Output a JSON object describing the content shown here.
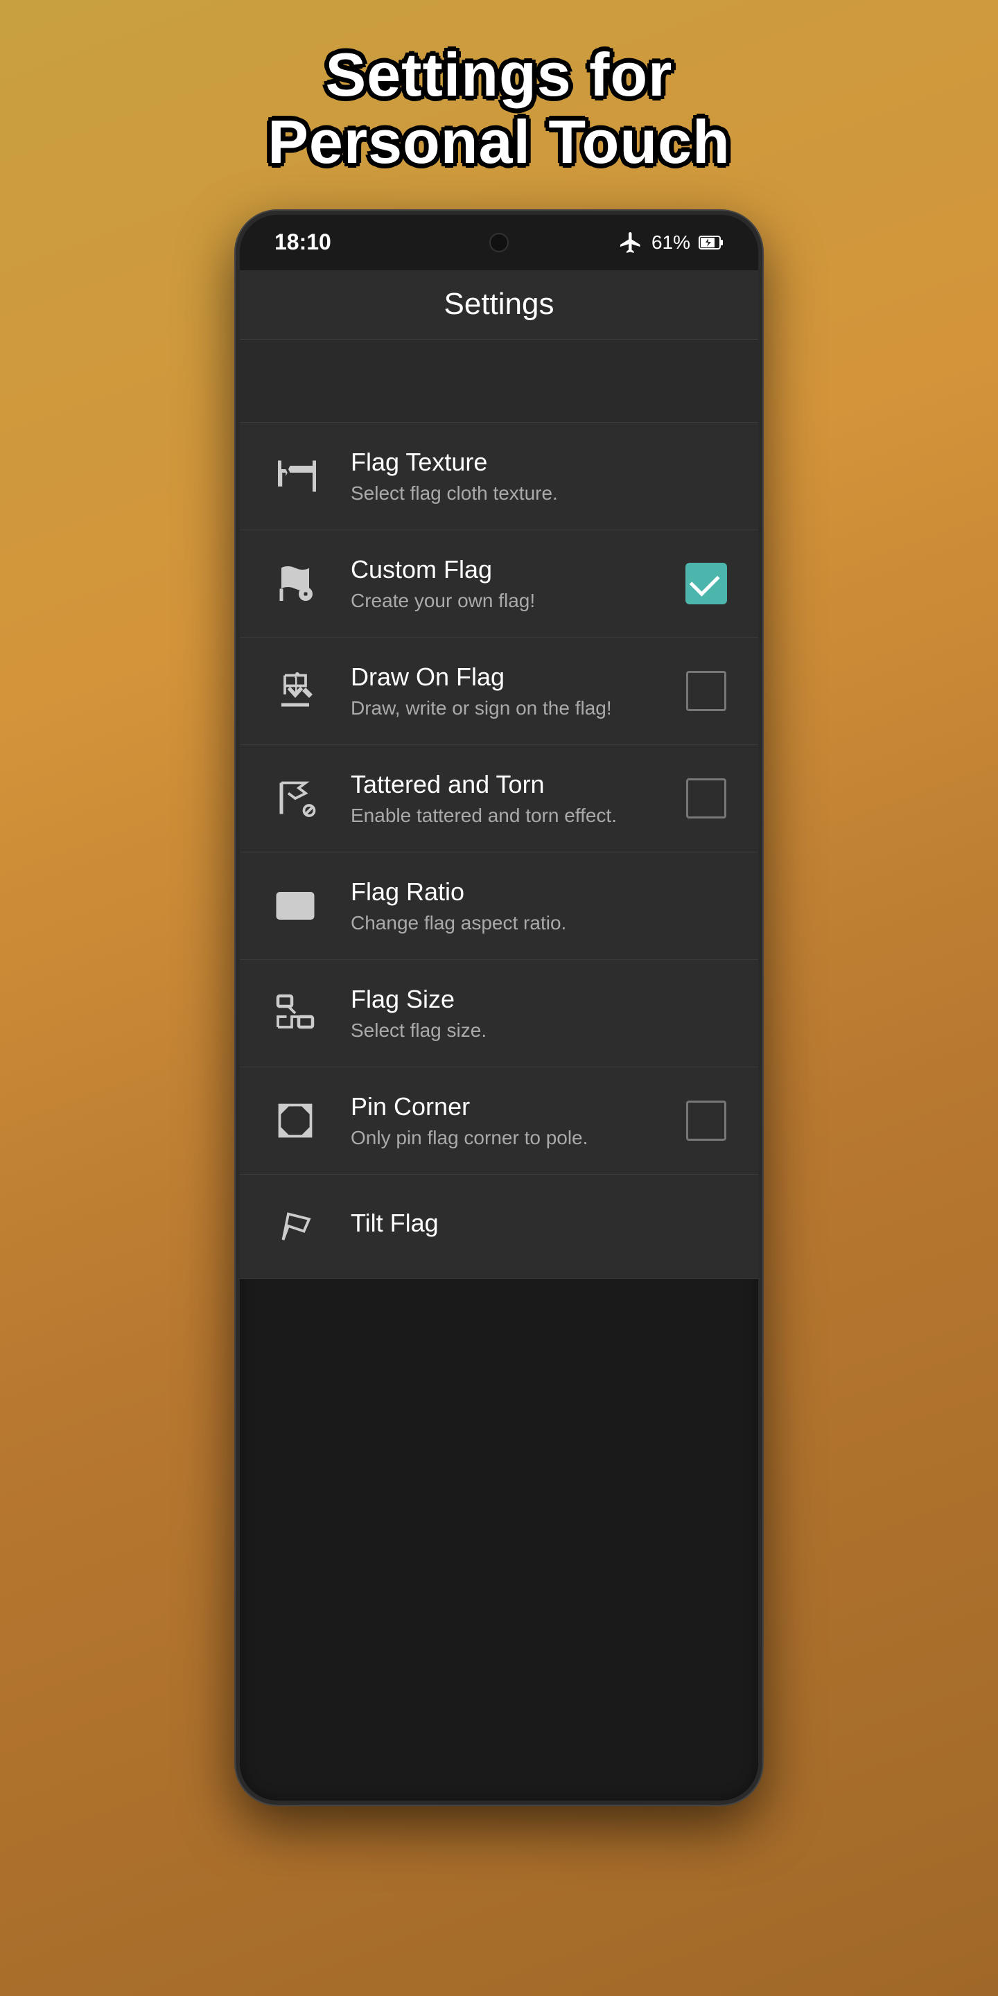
{
  "page": {
    "title_line1": "Settings for",
    "title_line2": "Personal Touch"
  },
  "status_bar": {
    "time": "18:10",
    "battery_percent": "61%",
    "plane_mode": true
  },
  "app_bar": {
    "title": "Settings"
  },
  "settings_items": [
    {
      "id": "flag-texture",
      "icon": "flag-texture-icon",
      "title": "Flag Texture",
      "subtitle": "Select flag cloth texture.",
      "control": "none"
    },
    {
      "id": "custom-flag",
      "icon": "custom-flag-icon",
      "title": "Custom Flag",
      "subtitle": "Create your own flag!",
      "control": "checkbox-checked"
    },
    {
      "id": "draw-on-flag",
      "icon": "draw-flag-icon",
      "title": "Draw On Flag",
      "subtitle": "Draw, write or sign on the flag!",
      "control": "checkbox-unchecked"
    },
    {
      "id": "tattered-and-torn",
      "icon": "tattered-flag-icon",
      "title": "Tattered and Torn",
      "subtitle": "Enable tattered and torn effect.",
      "control": "checkbox-unchecked"
    },
    {
      "id": "flag-ratio",
      "icon": "flag-ratio-icon",
      "title": "Flag Ratio",
      "subtitle": "Change flag aspect ratio.",
      "control": "none"
    },
    {
      "id": "flag-size",
      "icon": "flag-size-icon",
      "title": "Flag Size",
      "subtitle": "Select flag size.",
      "control": "none"
    },
    {
      "id": "pin-corner",
      "icon": "pin-corner-icon",
      "title": "Pin Corner",
      "subtitle": "Only pin flag corner to pole.",
      "control": "checkbox-unchecked"
    },
    {
      "id": "tilt-flag",
      "icon": "tilt-flag-icon",
      "title": "Tilt Flag",
      "subtitle": "",
      "control": "none"
    }
  ]
}
